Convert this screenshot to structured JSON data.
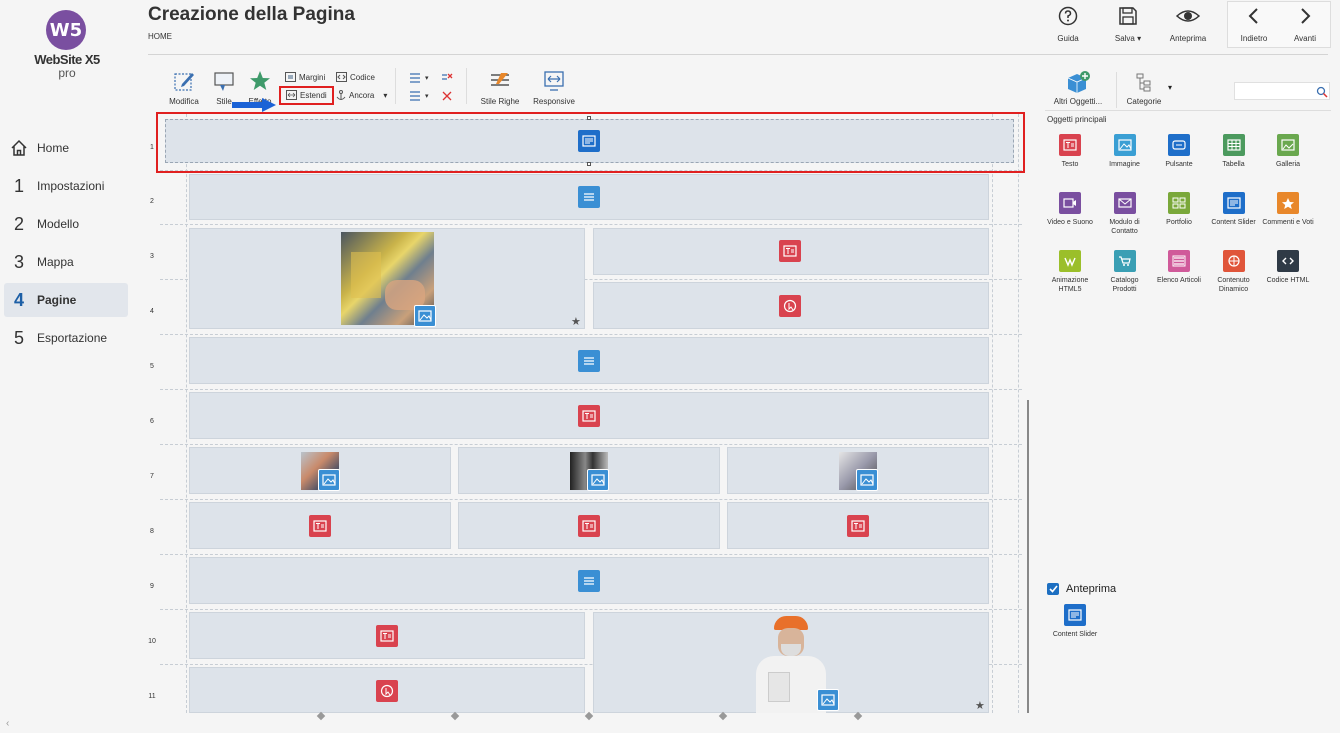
{
  "app": {
    "logo_mark": "W5",
    "logo_name": "WebSite X5",
    "logo_edition": "pro"
  },
  "sidebar": {
    "items": [
      {
        "num": "",
        "label": "Home"
      },
      {
        "num": "1",
        "label": "Impostazioni"
      },
      {
        "num": "2",
        "label": "Modello"
      },
      {
        "num": "3",
        "label": "Mappa"
      },
      {
        "num": "4",
        "label": "Pagine"
      },
      {
        "num": "5",
        "label": "Esportazione"
      }
    ]
  },
  "header": {
    "title": "Creazione della Pagina",
    "breadcrumb": "HOME",
    "guide_label": "Guida",
    "save_label": "Salva",
    "preview_label": "Anteprima",
    "back_label": "Indietro",
    "forward_label": "Avanti"
  },
  "toolbar": {
    "edit_label": "Modifica",
    "style_label": "Stile",
    "effect_label": "Effetto",
    "margins_label": "Margini",
    "code_label": "Codice",
    "extend_label": "Estendi",
    "anchor_label": "Ancora",
    "row_style_label": "Stile Righe",
    "responsive_label": "Responsive"
  },
  "grid": {
    "row_numbers": [
      "1",
      "2",
      "3",
      "4",
      "5",
      "6",
      "7",
      "8",
      "9",
      "10",
      "11"
    ]
  },
  "right_panel": {
    "other_objects_label": "Altri Oggetti...",
    "categories_label": "Categorie",
    "search_placeholder": "",
    "section_title": "Oggetti principali",
    "objects": [
      {
        "label": "Testo",
        "color": "#d9434f"
      },
      {
        "label": "Immagine",
        "color": "#3a9fd4"
      },
      {
        "label": "Pulsante",
        "color": "#1e6ec9"
      },
      {
        "label": "Tabella",
        "color": "#4c9a5e"
      },
      {
        "label": "Galleria",
        "color": "#6aa84f"
      },
      {
        "label": "Video e Suono",
        "color": "#7a4fa0"
      },
      {
        "label": "Modulo di Contatto",
        "color": "#7a4fa0"
      },
      {
        "label": "Portfolio",
        "color": "#7aa83a"
      },
      {
        "label": "Content Slider",
        "color": "#1e6ec9"
      },
      {
        "label": "Commenti e Voti",
        "color": "#e8872a"
      },
      {
        "label": "Animazione HTML5",
        "color": "#9bbf2a"
      },
      {
        "label": "Catalogo Prodotti",
        "color": "#3a9fb4"
      },
      {
        "label": "Elenco Articoli",
        "color": "#d05a9a"
      },
      {
        "label": "Contenuto Dinamico",
        "color": "#e0553a"
      },
      {
        "label": "Codice HTML",
        "color": "#2f3a46"
      }
    ],
    "preview_checkbox_label": "Anteprima",
    "preview_checked": true,
    "preview_item_label": "Content Slider"
  }
}
